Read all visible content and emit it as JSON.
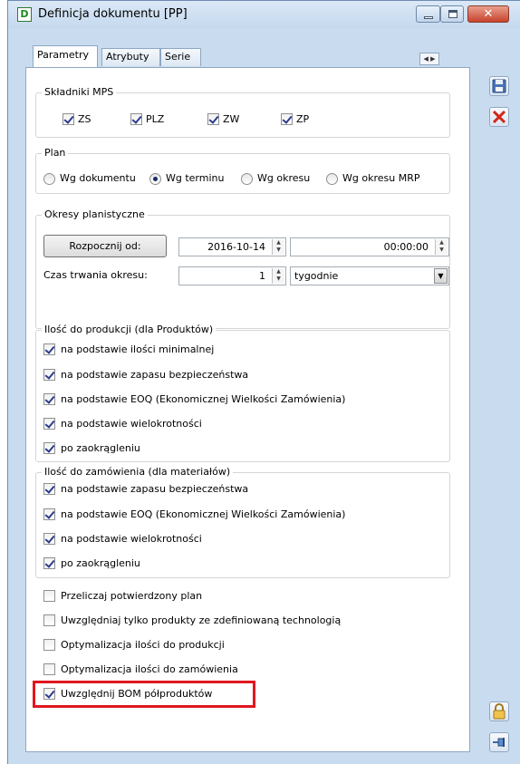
{
  "window": {
    "title": "Definicja dokumentu [PP]",
    "app_icon_glyph": "D",
    "close_glyph": "✕",
    "colors": {
      "accent": "#c9dcef",
      "close": "#c8422c",
      "highlight": "#e0171f"
    }
  },
  "tabs": [
    {
      "label": "Parametry",
      "active": true
    },
    {
      "label": "Atrybuty",
      "active": false
    },
    {
      "label": "Serie",
      "active": false
    }
  ],
  "tab_scroll_glyph": "◀ ▶",
  "skladniki": {
    "title": "Składniki MPS",
    "items": [
      {
        "label": "ZS",
        "checked": true
      },
      {
        "label": "PLZ",
        "checked": true
      },
      {
        "label": "ZW",
        "checked": true
      },
      {
        "label": "ZP",
        "checked": true
      }
    ]
  },
  "plan": {
    "title": "Plan",
    "options": [
      {
        "label": "Wg dokumentu",
        "selected": false
      },
      {
        "label": "Wg terminu",
        "selected": true
      },
      {
        "label": "Wg okresu",
        "selected": false
      },
      {
        "label": "Wg okresu MRP",
        "selected": false
      }
    ]
  },
  "okresy": {
    "title": "Okresy planistyczne",
    "start_button": "Rozpocznij od:",
    "date_value": "2016-10-14",
    "time_value": "00:00:00",
    "duration_label": "Czas trwania okresu:",
    "duration_value": "1",
    "unit_value": "tygodnie"
  },
  "ilosc_produkcji": {
    "title": "Ilość do produkcji (dla Produktów)",
    "items": [
      {
        "label": "na podstawie ilości minimalnej",
        "checked": true
      },
      {
        "label": "na podstawie zapasu bezpieczeństwa",
        "checked": true
      },
      {
        "label": "na podstawie EOQ (Ekonomicznej Wielkości Zamówienia)",
        "checked": true
      },
      {
        "label": "na podstawie wielokrotności",
        "checked": true
      },
      {
        "label": "po zaokrągleniu",
        "checked": true
      }
    ]
  },
  "ilosc_zamowienia": {
    "title": "Ilość do zamówienia (dla materiałów)",
    "items": [
      {
        "label": "na podstawie zapasu bezpieczeństwa",
        "checked": true
      },
      {
        "label": "na podstawie EOQ (Ekonomicznej Wielkości Zamówienia)",
        "checked": true
      },
      {
        "label": "na podstawie wielokrotności",
        "checked": true
      },
      {
        "label": "po zaokrągleniu",
        "checked": true
      }
    ]
  },
  "options": [
    {
      "label": "Przeliczaj potwierdzony plan",
      "checked": false
    },
    {
      "label": "Uwzględniaj tylko produkty ze zdefiniowaną technologią",
      "checked": false
    },
    {
      "label": "Optymalizacja ilości do produkcji",
      "checked": false
    },
    {
      "label": "Optymalizacja ilości do zamówienia",
      "checked": false
    },
    {
      "label": "Uwzględnij BOM półproduktów",
      "checked": true
    }
  ],
  "side_buttons": {
    "save_icon": "save-icon",
    "delete_icon": "delete-icon",
    "lock_icon": "lock-icon",
    "pin_icon": "pin-icon"
  }
}
